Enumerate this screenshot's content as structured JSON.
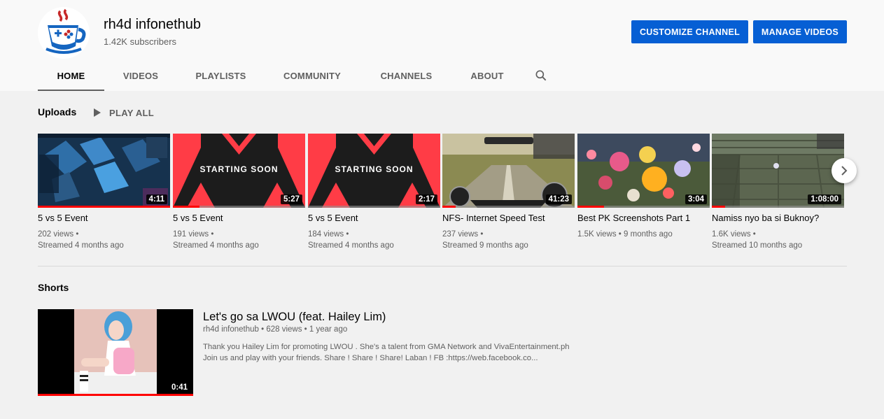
{
  "channel": {
    "name": "rh4d infonethub",
    "subscribers": "1.42K subscribers"
  },
  "buttons": {
    "customize": "CUSTOMIZE CHANNEL",
    "manage": "MANAGE VIDEOS"
  },
  "tabs": [
    {
      "label": "HOME",
      "active": true
    },
    {
      "label": "VIDEOS"
    },
    {
      "label": "PLAYLISTS"
    },
    {
      "label": "COMMUNITY"
    },
    {
      "label": "CHANNELS"
    },
    {
      "label": "ABOUT"
    }
  ],
  "search_tab_icon": "search-icon",
  "uploads": {
    "title": "Uploads",
    "play_all": "PLAY ALL",
    "videos": [
      {
        "title": "5 vs 5 Event",
        "views": "202 views •",
        "streamed": "Streamed 4 months ago",
        "duration": "4:11",
        "watched": 1.0,
        "thumb": "game-blue"
      },
      {
        "title": "5 vs 5 Event",
        "views": "191 views •",
        "streamed": "Streamed 4 months ago",
        "duration": "5:27",
        "watched": 0.2,
        "thumb": "starting-soon"
      },
      {
        "title": "5 vs 5 Event",
        "views": "184 views •",
        "streamed": "Streamed 4 months ago",
        "duration": "2:17",
        "watched": 0.0,
        "thumb": "starting-soon"
      },
      {
        "title": "NFS- Internet Speed Test",
        "views": "237 views •",
        "streamed": "Streamed 9 months ago",
        "duration": "41:23",
        "watched": 0.1,
        "thumb": "racing"
      },
      {
        "title": "Best PK Screenshots Part 1",
        "views": "1.5K views • 9 months ago",
        "streamed": "",
        "duration": "3:04",
        "watched": 0.2,
        "thumb": "battle"
      },
      {
        "title": "Namiss nyo ba si Buknoy?",
        "views": "1.6K views •",
        "streamed": "Streamed 10 months ago",
        "duration": "1:08:00",
        "watched": 0.1,
        "thumb": "stone-floor"
      }
    ],
    "starting_soon_text": "STARTING SOON"
  },
  "shorts": {
    "title": "Shorts",
    "video_title": "Let's go sa LWOU (feat. Hailey Lim)",
    "meta": "rh4d infonethub • 628 views • 1 year ago",
    "description_line1": "Thank you Hailey Lim for promoting LWOU . She's a talent from GMA Network and VivaEntertainment.ph",
    "description_line2": "Join us and play with your friends. Share ! Share ! Share! Laban ! FB :https://web.facebook.co...",
    "duration": "0:41",
    "watched": 1.0
  },
  "icons": {
    "next": "chevron-right-icon",
    "play": "play-icon",
    "avatar": "gamepad-cup-logo-icon"
  },
  "colors": {
    "accent": "#065fd4",
    "progress": "#ff0000",
    "header_bg": "#f9f9f9",
    "page_bg": "#f1f1f1"
  }
}
